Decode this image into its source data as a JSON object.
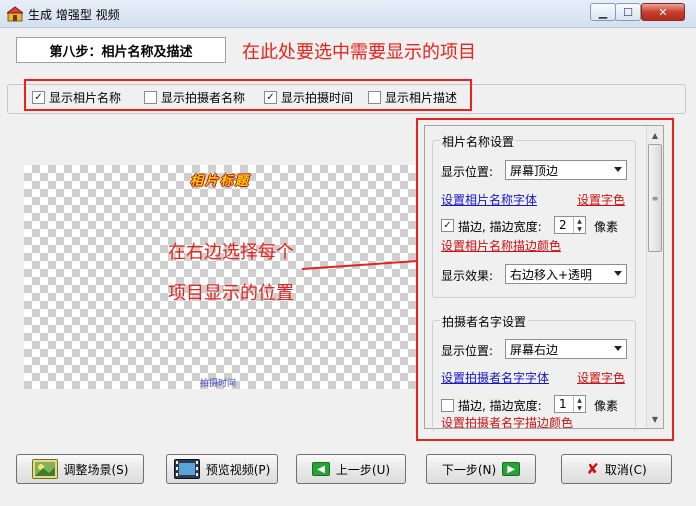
{
  "window": {
    "title": "生成 增强型 视频",
    "minimize_glyph": "▁",
    "maximize_glyph": "☐",
    "close_glyph": "✕"
  },
  "step": {
    "label": "第八步：相片名称及描述"
  },
  "annotations": {
    "top": "在此处要选中需要显示的项目",
    "middle_line1": "在右边选择每个",
    "middle_line2": "项目显示的位置",
    "color": "#e8231c"
  },
  "options": [
    {
      "label": "显示相片名称",
      "checked": true
    },
    {
      "label": "显示拍摄者名称",
      "checked": false
    },
    {
      "label": "显示拍摄时间",
      "checked": true
    },
    {
      "label": "显示相片描述",
      "checked": false
    }
  ],
  "preview": {
    "title_text": "相片标题",
    "photographer_text": "拍摄时间"
  },
  "settings": {
    "photo_name": {
      "group_title": "相片名称设置",
      "position_label": "显示位置:",
      "position_value": "屏幕顶边",
      "font_link": "设置相片名称字体",
      "color_link": "设置字色",
      "outline_checked": true,
      "outline_label": "描边, 描边宽度:",
      "outline_width": "2",
      "unit": "像素",
      "outline_color_link": "设置相片名称描边颜色",
      "effect_label": "显示效果:",
      "effect_value": "右边移入+透明"
    },
    "photographer": {
      "group_title": "拍摄者名字设置",
      "position_label": "显示位置:",
      "position_value": "屏幕右边",
      "font_link": "设置拍摄者名字字体",
      "color_link": "设置字色",
      "outline_checked": false,
      "outline_label": "描边, 描边宽度:",
      "outline_width": "1",
      "unit": "像素",
      "outline_color_link": "设置拍摄者名字描边颜色"
    }
  },
  "buttons": {
    "adjust_scene": "调整场景(S)",
    "preview_video": "预览视频(P)",
    "prev_step": "上一步(U)",
    "next_step": "下一步(N)",
    "cancel": "取消(C)"
  }
}
